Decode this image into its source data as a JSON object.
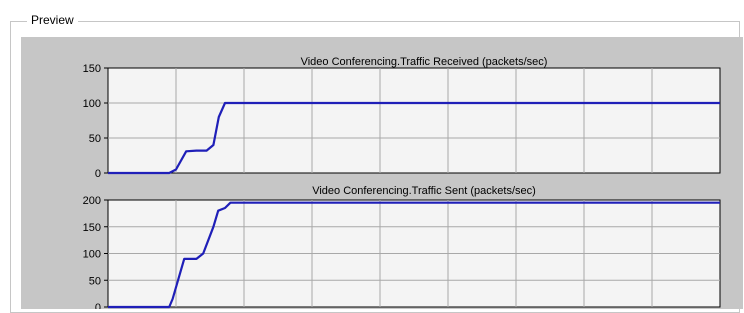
{
  "window": {
    "group_label": "Preview"
  },
  "chart_data": [
    {
      "type": "line",
      "title": "Video Conferencing.Traffic Received (packets/sec)",
      "xlabel": "",
      "ylabel": "",
      "ylim": [
        0,
        150
      ],
      "yticks": [
        0,
        50,
        100,
        150
      ],
      "xlim": [
        0,
        9
      ],
      "xticks": [
        0,
        1,
        2,
        3,
        4,
        5,
        6,
        7,
        8,
        9
      ],
      "grid": true,
      "line_color": "#1f1fb8",
      "series": [
        {
          "x": [
            0,
            0.9,
            1.0,
            1.15,
            1.3,
            1.45,
            1.55,
            1.63,
            1.72,
            1.8,
            1.95,
            9
          ],
          "values": [
            0,
            0,
            5,
            31,
            32,
            32,
            40,
            80,
            100,
            100,
            100,
            100
          ]
        }
      ]
    },
    {
      "type": "line",
      "title": "Video Conferencing.Traffic Sent (packets/sec)",
      "xlabel": "",
      "ylabel": "",
      "ylim": [
        0,
        200
      ],
      "yticks": [
        0,
        50,
        100,
        150,
        200
      ],
      "xlim": [
        0,
        9
      ],
      "xticks": [
        0,
        1,
        2,
        3,
        4,
        5,
        6,
        7,
        8,
        9
      ],
      "grid": true,
      "line_color": "#1f1fb8",
      "series": [
        {
          "x": [
            0,
            0.9,
            0.95,
            1.12,
            1.3,
            1.4,
            1.55,
            1.62,
            1.72,
            1.8,
            1.95,
            9
          ],
          "values": [
            0,
            0,
            15,
            90,
            90,
            100,
            150,
            180,
            185,
            195,
            195,
            195
          ]
        }
      ]
    }
  ]
}
